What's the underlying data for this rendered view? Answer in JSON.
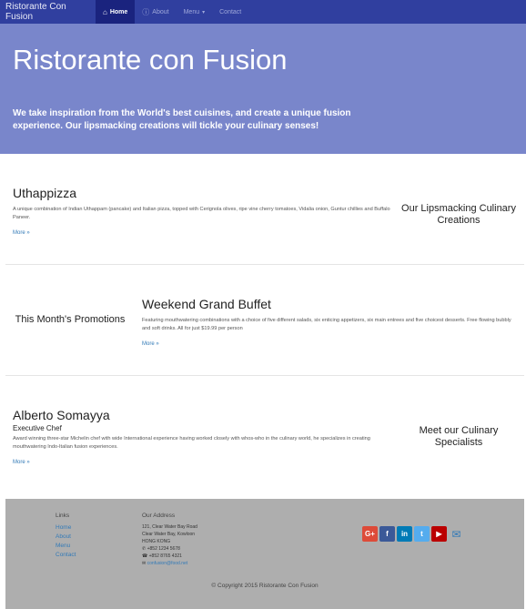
{
  "nav": {
    "brand": "Ristorante Con Fusion",
    "items": [
      {
        "icon": "home-icon",
        "label": "Home",
        "active": true
      },
      {
        "icon": "info-icon",
        "label": "About",
        "active": false
      },
      {
        "icon": "",
        "label": "Menu",
        "active": false
      },
      {
        "icon": "",
        "label": "Contact",
        "active": false
      }
    ]
  },
  "jumbotron": {
    "title": "Ristorante con Fusion",
    "text": "We take inspiration from the World's best cuisines, and create a unique fusion experience. Our lipsmacking creations will tickle your culinary senses!"
  },
  "sections": [
    {
      "title": "Uthappizza",
      "subtitle": "",
      "description": "A unique combination of Indian Uthappam (pancake) and Italian pizza, topped with Cerignola olives, ripe vine cherry tomatoes, Vidalia onion, Guntur chillies and Buffalo Paneer.",
      "more": "More »",
      "side": "Our Lipsmacking Culinary Creations"
    },
    {
      "title": "Weekend Grand Buffet",
      "subtitle": "",
      "description": "Featuring mouthwatering combinations with a choice of five different salads, six enticing appetizers, six main entrees and five choicest desserts. Free flowing bubbly and soft drinks. All for just $19.99 per person",
      "more": "More »",
      "side": "This Month's Promotions"
    },
    {
      "title": "Alberto Somayya",
      "subtitle": "Executive Chef",
      "description": "Award winning three-star Michelin chef with wide International experience having worked closely with whos-who in the culinary world, he specializes in creating mouthwatering Indo-Italian fusion experiences.",
      "more": "More »",
      "side": "Meet our Culinary Specialists"
    }
  ],
  "footer": {
    "links_heading": "Links",
    "links": [
      "Home",
      "About",
      "Menu",
      "Contact"
    ],
    "address_heading": "Our Address",
    "address_lines": [
      "121, Clear Water Bay Road",
      "Clear Water Bay, Kowloon",
      "HONG KONG"
    ],
    "phone": "+852 1234 5678",
    "fax": "+852 8765 4321",
    "email": "confusion@food.net",
    "social": [
      {
        "name": "google-plus",
        "label": "G+",
        "color": "#dd4b39"
      },
      {
        "name": "facebook",
        "label": "f",
        "color": "#3b5998"
      },
      {
        "name": "linkedin",
        "label": "in",
        "color": "#007bb6"
      },
      {
        "name": "twitter",
        "label": "t",
        "color": "#55acee"
      },
      {
        "name": "youtube",
        "label": "▶",
        "color": "#bb0000"
      }
    ],
    "copyright": "© Copyright 2015 Ristorante Con Fusion"
  },
  "colors": {
    "navbar": "#303f9f",
    "navbar_active": "#1a237e",
    "jumbotron": "#7986cb",
    "link": "#337ab7",
    "footer": "#aeaeae"
  }
}
